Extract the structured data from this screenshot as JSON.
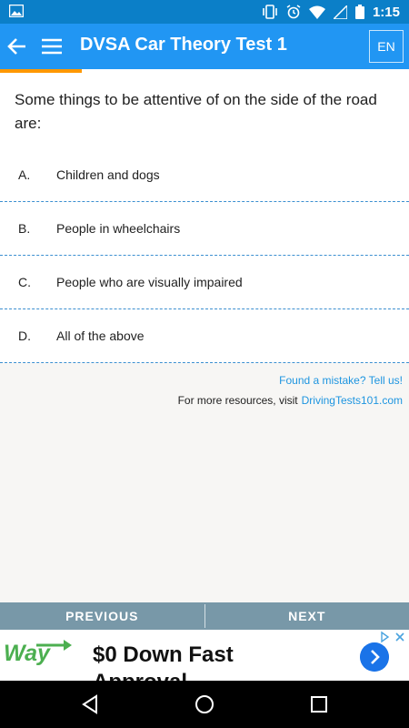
{
  "status_bar": {
    "time": "1:15"
  },
  "app_bar": {
    "title": "DVSA Car Theory Test 1",
    "language": "EN",
    "progress": 0.2
  },
  "question": {
    "text": "Some things to be attentive of on the side of the road are:"
  },
  "options": [
    {
      "letter": "A.",
      "text": "Children and dogs"
    },
    {
      "letter": "B.",
      "text": "People in wheelchairs"
    },
    {
      "letter": "C.",
      "text": "People who are visually impaired"
    },
    {
      "letter": "D.",
      "text": "All of the above"
    }
  ],
  "links": {
    "mistake": "Found a mistake? Tell us!",
    "resources_prefix": "For more resources, visit",
    "resources_link": "DrivingTests101.com"
  },
  "navigation": {
    "previous": "PREVIOUS",
    "next": "NEXT"
  },
  "ad": {
    "brand": "Way",
    "headline": "$0 Down Fast",
    "headline_cont": "Approval"
  },
  "colors": {
    "status": "#0b7fc8",
    "app_bar": "#2196f3",
    "progress": "#ff9800",
    "nav": "#7898a8",
    "link": "#1e95e0",
    "ad_button": "#1a73e8"
  }
}
